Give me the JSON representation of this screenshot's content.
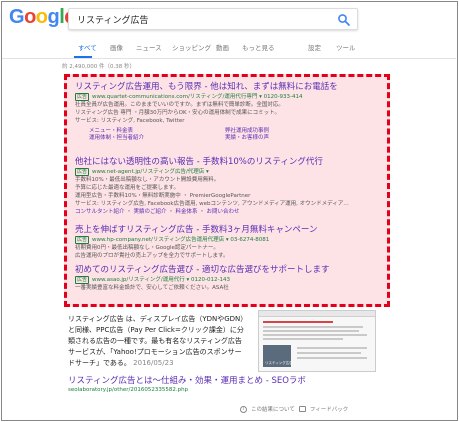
{
  "brand": {
    "logo_letters": [
      "G",
      "o",
      "o",
      "g",
      "l",
      "e"
    ],
    "logo_colors": [
      "#4285f4",
      "#ea4335",
      "#fbbc05",
      "#4285f4",
      "#34a853",
      "#ea4335"
    ]
  },
  "search": {
    "query": "リスティング広告"
  },
  "tabs": [
    {
      "label": "すべて",
      "active": true
    },
    {
      "label": "画像"
    },
    {
      "label": "ニュース"
    },
    {
      "label": "ショッピング"
    },
    {
      "label": "動画"
    },
    {
      "label": "もっと見る"
    },
    {
      "label": "設定"
    },
    {
      "label": "ツール"
    }
  ],
  "result_count": "約 2,490,000 件（0.38 秒）",
  "ads": [
    {
      "title": "リスティング広告運用、もう限界 - 他は知れ、まずは無料にお電話を",
      "badge": "広告",
      "url": "www.quartet-communications.com/リスティング/運用代行専門 ▾  0120-933-414",
      "desc": [
        "社員全員が広告運用。このままでいいのですか。まずは無料で簡単診断。全国対応。",
        "リスティング広告 専門 ・月額30万円からOK・安心の運用体制で成果にコミット。",
        "サービス: リスティング, Facebook, Twitter"
      ],
      "sitelinks": [
        "メニュー・料金表",
        "弊社運用成功事例",
        "運用体制・担当者紹介",
        "実績・お客様の声"
      ]
    },
    {
      "title": "他社にはない透明性の高い報告 - 手数料10%のリスティング代行",
      "badge": "広告",
      "url": "www.net-agent.jp/リスティング広告/代理店 ▾",
      "desc": [
        "手数料10%・最低出稿額なし・アカウント開設費用無料。",
        "予算に応じた最適な運用をご提案します。",
        "運用型広告・手数料10%・無料診断実施中 ・ PremierGooglePartner",
        "サービス: リスティング広告, Facebook広告運用, webコンテンツ, アウンドメディア運用, オウンドメディア…"
      ],
      "links": "コンサルタント紹介 ・ 実績のご紹介 ・ 料金体系 ・ お問い合わせ"
    },
    {
      "title": "売上を伸ばすリスティング広告 - 手数料3ヶ月無料キャンペーン",
      "badge": "広告",
      "url": "www.hp-company.net/リスティング広告運用代理店 ▾  03-6274-8081",
      "desc": [
        "初期費用0円・最低出稿額なし・Google認定パートナー。",
        "広告運用のプロが貴社の売上アップを全力でサポートします。"
      ]
    },
    {
      "title": "初めてのリスティング広告選び - 適切な広告選びをサポートします",
      "badge": "広告",
      "url": "www.asao.jp/リスティング/運用代行 ▾  0120-012-143",
      "desc": [
        "一番実績豊富な料金設計で、安心してご依頼ください。ASA社"
      ]
    }
  ],
  "organic": {
    "snippet": "リスティング広告 は、ディスプレイ広告（YDNやGDN）と同様、PPC広告（Pay Per Click=クリック課金）に分類される広告の一種です。最も有名なリスティング広告サービスが、「Yahoo!プロモーション広告のスポンサードサーチ」である。",
    "date": "2016/05/23",
    "thumb_label": "リスティング広告",
    "title": "リスティング広告とは～仕組み・効果・運用まとめ - SEOラボ",
    "url": "seolaboratory.jp/other/2016052335582.php"
  },
  "footer": {
    "about": "この結果について",
    "feedback": "フィードバック"
  }
}
